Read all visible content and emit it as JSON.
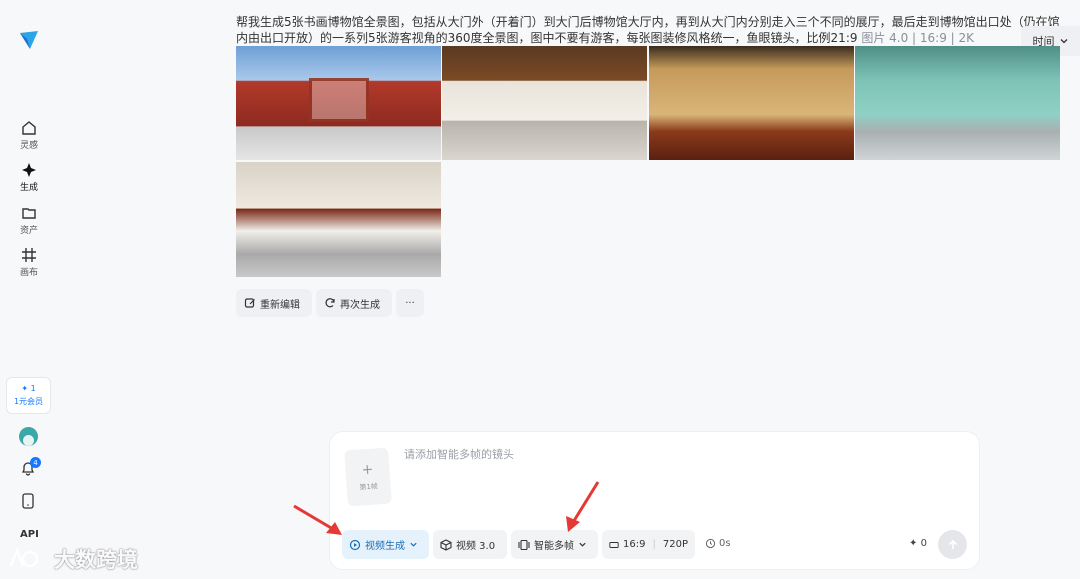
{
  "sidebar": {
    "items": [
      {
        "label": "灵感",
        "icon": "home-icon"
      },
      {
        "label": "生成",
        "icon": "sparkle-icon"
      },
      {
        "label": "资产",
        "icon": "folder-icon"
      },
      {
        "label": "画布",
        "icon": "canvas-icon"
      }
    ],
    "vip": {
      "points": "1",
      "label": "1元会员"
    },
    "notification_count": "4",
    "api_label": "API"
  },
  "prompt": {
    "text": "帮我生成5张书画博物馆全景图，包括从大门外（开着门）到大门后博物馆大厅内，再到从大门内分别走入三个不同的展厅，最后走到博物馆出口处（仍在馆内由出口开放）的一系列5张游客视角的360度全景图，图中不要有游客，每张图装修风格统一，鱼眼镜头，比例21:9",
    "meta_model": "图片 4.0",
    "meta_ratio": "16:9",
    "meta_res": "2K"
  },
  "sort": {
    "label": "时间"
  },
  "images": [
    {
      "alt": "书画博物馆大门"
    },
    {
      "alt": "博物馆大厅"
    },
    {
      "alt": "展厅一"
    },
    {
      "alt": "展厅二"
    },
    {
      "alt": "出口"
    }
  ],
  "actions": {
    "reedit": "重新编辑",
    "regenerate": "再次生成",
    "more": "···"
  },
  "composer": {
    "placeholder": "请添加智能多帧的镜头",
    "frame_label": "第1帧",
    "mode": "视频生成",
    "model": "视频 3.0",
    "multiframe": "智能多帧",
    "ratio": "16:9",
    "resolution": "720P",
    "duration": "0s",
    "credits": "0"
  },
  "watermark": "大数跨境",
  "colors": {
    "accent": "#1677ff",
    "annotation_arrow": "#e53935"
  }
}
